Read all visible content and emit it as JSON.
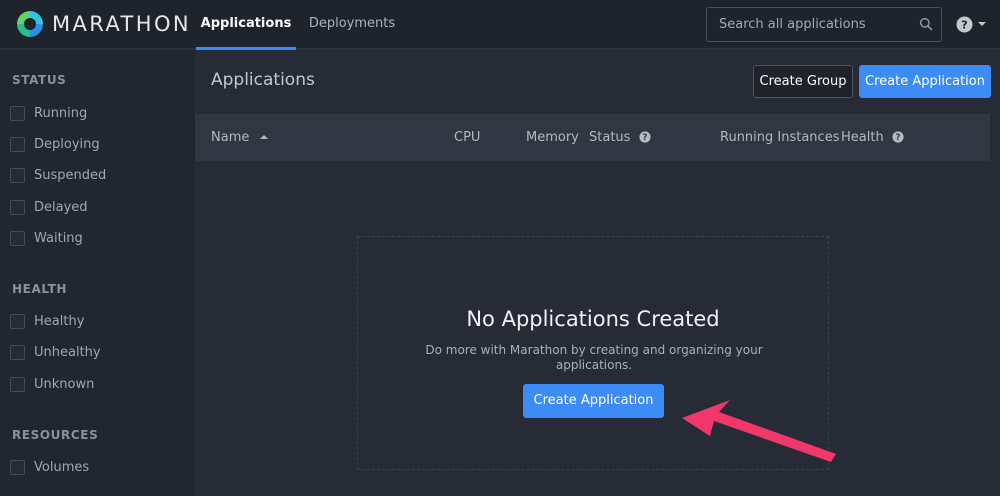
{
  "brand": {
    "name": "MARATHON"
  },
  "nav": {
    "tabs": [
      {
        "label": "Applications",
        "active": true
      },
      {
        "label": "Deployments",
        "active": false
      }
    ]
  },
  "search": {
    "placeholder": "Search all applications",
    "icon": "search-icon"
  },
  "help": {
    "icon": "question-circle-icon"
  },
  "sidebar": {
    "sections": [
      {
        "title": "STATUS",
        "items": [
          "Running",
          "Deploying",
          "Suspended",
          "Delayed",
          "Waiting"
        ]
      },
      {
        "title": "HEALTH",
        "items": [
          "Healthy",
          "Unhealthy",
          "Unknown"
        ]
      },
      {
        "title": "RESOURCES",
        "items": [
          "Volumes"
        ]
      }
    ]
  },
  "main": {
    "title": "Applications",
    "create_group_label": "Create Group",
    "create_application_label": "Create Application"
  },
  "table": {
    "columns": [
      "Name",
      "CPU",
      "Memory",
      "Status",
      "Running Instances",
      "Health"
    ],
    "sort_column": "Name",
    "sort_direction": "ascending",
    "help_columns": [
      "Status",
      "Health"
    ]
  },
  "empty_state": {
    "title": "No Applications Created",
    "text": "Do more with Marathon by creating and organizing your applications.",
    "button_label": "Create Application"
  },
  "colors": {
    "accent": "#3d8cf5",
    "background": "#262b36",
    "topbar": "#1f232c",
    "sidebar": "#22262f",
    "annotation_arrow": "#f2386a"
  }
}
